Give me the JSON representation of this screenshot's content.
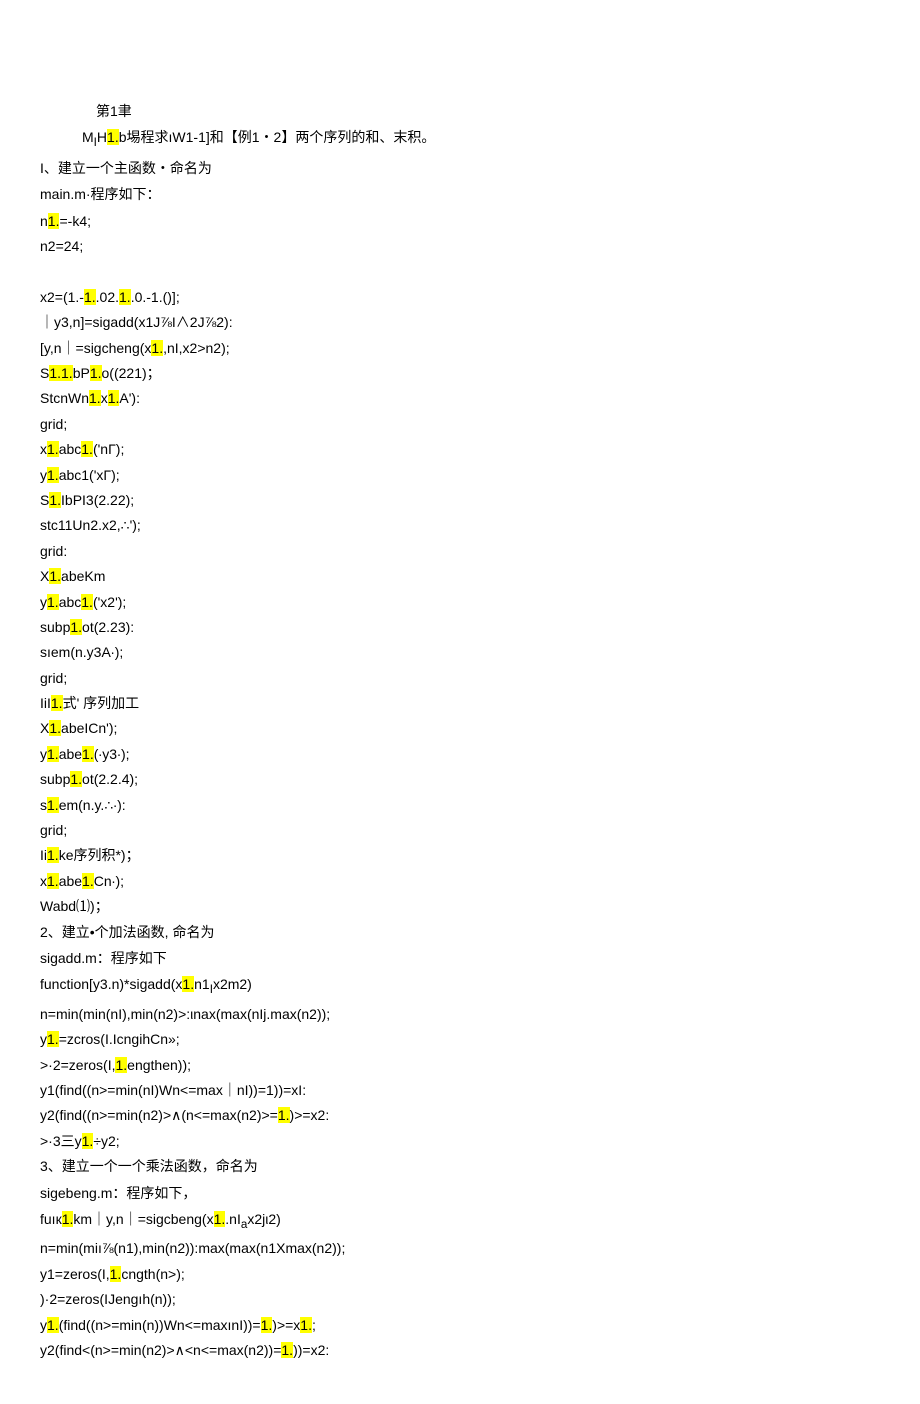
{
  "heading": "第1聿",
  "intro": {
    "p1_a": "M",
    "p1_sub": "I",
    "p1_b": "H",
    "p1_hl": "1.",
    "p1_c": "b埸程求ıW1-1]和【例1・2】两个序列的和、末积。"
  },
  "s1_title": "I、建立一个主函数・命名为",
  "s1_sub": "main.m·程序如下：",
  "code1": {
    "l1_a": "n",
    "l1_hl": "1.",
    "l1_b": "=-k4;",
    "l2": "n2=24;",
    "l3_a": "x2=(1.-",
    "l3_hl1": "1.",
    "l3_b": ".02.",
    "l3_hl2": "1.",
    "l3_c": ".0.-1.()];",
    "l4": "｜y3,n]=sigadd(x1J⅞I∧2J⅞2):",
    "l5_a": "[y,n｜=sigcheng(x",
    "l5_hl": "1.",
    "l5_b": ",nI,x2>n2);",
    "l6_a": "S",
    "l6_hl1": "1.1.",
    "l6_b": "bP",
    "l6_hl2": "1.",
    "l6_c": "o((221)；",
    "l7_a": "StcnWn",
    "l7_hl": "1.",
    "l7_b": "x",
    "l7_hl2": "1.",
    "l7_c": "A'):",
    "l8": "grid;",
    "l9_a": "x",
    "l9_hl": "1.",
    "l9_b": "abc",
    "l9_hl2": "1.",
    "l9_c": "('nΓ);",
    "l10_a": "y",
    "l10_hl": "1.",
    "l10_b": "abc1('xΓ);",
    "l11_a": "S",
    "l11_hl": "1.",
    "l11_b": "IbPI3(2.22);",
    "l12": "stc11Un2.x2,∴');",
    "l13": "grid:",
    "l14_a": "X",
    "l14_hl": "1.",
    "l14_b": "abeKm",
    "l15_a": "y",
    "l15_hl": "1.",
    "l15_b": "abc",
    "l15_hl2": "1.",
    "l15_c": "('x2');",
    "l16_a": "subp",
    "l16_hl": "1.",
    "l16_b": "ot(2.23):",
    "l17": "sıem(n.y3A∙);",
    "l18": "grid;",
    "l19_a": "IiI",
    "l19_hl": "1.",
    "l19_b": "式' 序列加工",
    "l20_a": "X",
    "l20_hl": "1.",
    "l20_b": "abeICn');",
    "l21_a": "y",
    "l21_hl": "1.",
    "l21_b": "abe",
    "l21_hl2": "1.",
    "l21_c": "(∙y3∙);",
    "l22_a": "subp",
    "l22_hl": "1.",
    "l22_b": "ot(2.2.4);",
    "l23_a": "s",
    "l23_hl": "1.",
    "l23_b": "em(n.y.∴∙):",
    "l24": "grid;",
    "l25_a": "Ii",
    "l25_hl": "1.",
    "l25_b": "ke序列积*)；",
    "l26_a": "x",
    "l26_hl": "1.",
    "l26_b": "abe",
    "l26_hl2": "1.",
    "l26_c": "Cn∙);",
    "l27": "Wabd⑴)；"
  },
  "s2_title": "2、建立•个加法函数, 命名为",
  "s2_sub": "sigadd.m：程序如下",
  "code2": {
    "l1_a": "function[y3.n)*sigadd(x",
    "l1_hl": "1.",
    "l1_b": "n1",
    "l1_sub": "I",
    "l1_c": "x2m2)",
    "l2": "n=min(min(nI),min(n2)>:ιnax(max(nIj.max(n2));",
    "l3_a": "y",
    "l3_hl": "1.",
    "l3_b": "=zcros(I.IcngihCn»;",
    "l4_a": ">·2=zeros(I,",
    "l4_hl": "1.",
    "l4_b": "engthen));",
    "l5": "y1(find((n>=min(nI)Wn<=max｜nI))=1))=xI:",
    "l6_a": "y2(find((n>=min(n2)>∧(n<=max(n2)>=",
    "l6_hl": "1.",
    "l6_b": ")>=x2:",
    "l7_a": ">·3三y",
    "l7_hl": "1.",
    "l7_b": "÷y2;"
  },
  "s3_title": "3、建立一个一个乘法函数，命名为",
  "s3_sub": "sigebeng.m：程序如下，",
  "code3": {
    "l1_a": "fuıк",
    "l1_hl": "1.",
    "l1_b": "km｜y,n｜=sigcbeng(x",
    "l1_hl2": "1.",
    "l1_c": ".nI",
    "l1_sub": "a",
    "l1_d": "x2jι2)",
    "l2": "n=min(miı⅞(n1),min(n2)):max(max(n1Xmax(n2));",
    "l3_a": "y1=zeros(I,",
    "l3_hl": "1.",
    "l3_b": "cngth(n>);",
    "l4": ")·2=zeros(IJengıh(n));",
    "l5_a": "y",
    "l5_hl": "1.",
    "l5_b": "(find((n>=min(n))Wn<=maxınI))=",
    "l5_hl2": "1.",
    "l5_c": ")>=x",
    "l5_hl3": "1.",
    "l5_d": ";",
    "l6_a": "y2(find<(n>=min(n2)>∧<n<=max(n2))=",
    "l6_hl": "1.",
    "l6_b": "))=x2:"
  }
}
